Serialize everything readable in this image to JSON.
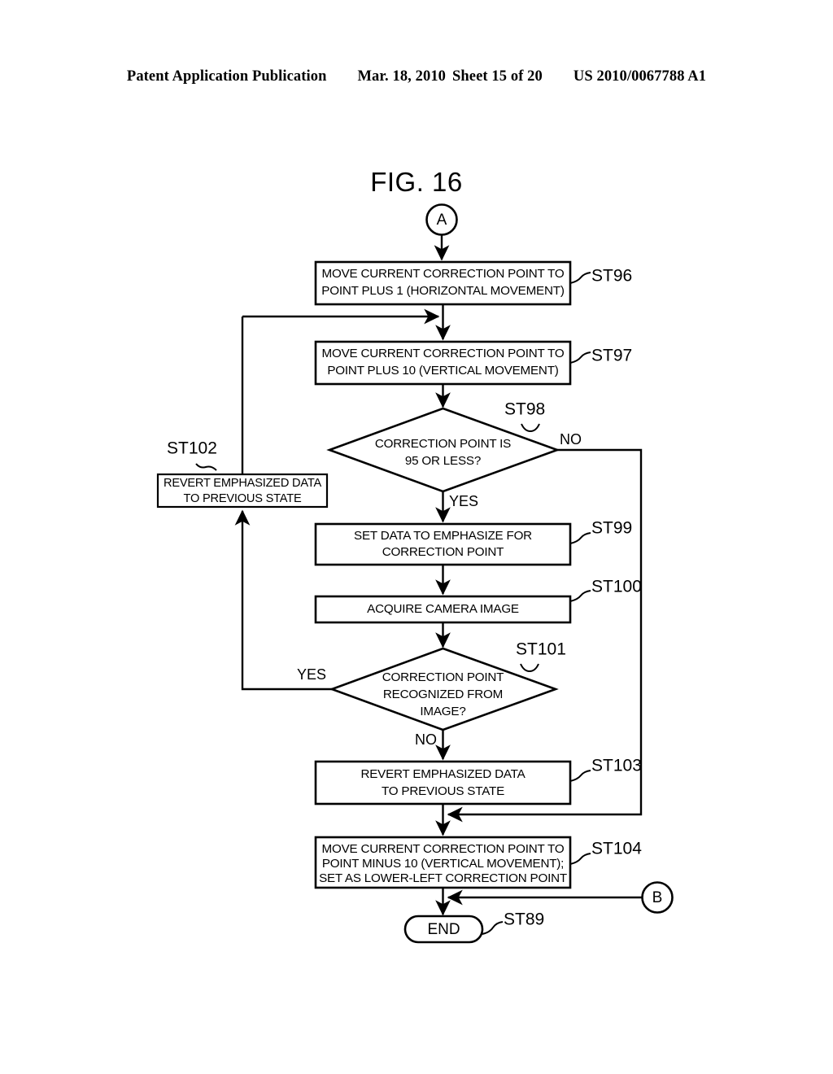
{
  "header": {
    "publication": "Patent Application Publication",
    "date": "Mar. 18, 2010",
    "sheet": "Sheet 15 of 20",
    "patent_number": "US 2010/0067788 A1"
  },
  "figure": {
    "title": "FIG. 16"
  },
  "flowchart": {
    "connector_in": {
      "label": "A",
      "ref": ""
    },
    "connector_b": {
      "label": "B"
    },
    "nodes": [
      {
        "id": "st96",
        "ref": "ST96",
        "type": "process",
        "lines": [
          "MOVE CURRENT CORRECTION POINT TO",
          "POINT PLUS 1 (HORIZONTAL MOVEMENT)"
        ]
      },
      {
        "id": "st97",
        "ref": "ST97",
        "type": "process",
        "lines": [
          "MOVE CURRENT CORRECTION POINT TO",
          "POINT PLUS 10 (VERTICAL MOVEMENT)"
        ]
      },
      {
        "id": "st98",
        "ref": "ST98",
        "type": "decision",
        "lines": [
          "CORRECTION POINT IS",
          "95 OR LESS?"
        ],
        "yes_label": "YES",
        "no_label": "NO"
      },
      {
        "id": "st102",
        "ref": "ST102",
        "type": "process",
        "lines": [
          "REVERT EMPHASIZED DATA",
          "TO PREVIOUS STATE"
        ]
      },
      {
        "id": "st99",
        "ref": "ST99",
        "type": "process",
        "lines": [
          "SET DATA TO EMPHASIZE FOR",
          "CORRECTION POINT"
        ]
      },
      {
        "id": "st100",
        "ref": "ST100",
        "type": "process",
        "lines": [
          "ACQUIRE CAMERA IMAGE"
        ]
      },
      {
        "id": "st101",
        "ref": "ST101",
        "type": "decision",
        "lines": [
          "CORRECTION POINT",
          "RECOGNIZED FROM",
          "IMAGE?"
        ],
        "yes_label": "YES",
        "no_label": "NO"
      },
      {
        "id": "st103",
        "ref": "ST103",
        "type": "process",
        "lines": [
          "REVERT EMPHASIZED DATA",
          "TO PREVIOUS STATE"
        ]
      },
      {
        "id": "st104",
        "ref": "ST104",
        "type": "process",
        "lines": [
          "MOVE CURRENT CORRECTION POINT TO",
          "POINT MINUS 10 (VERTICAL MOVEMENT);",
          "SET AS LOWER-LEFT CORRECTION POINT"
        ]
      },
      {
        "id": "st89",
        "ref": "ST89",
        "type": "terminator",
        "lines": [
          "END"
        ]
      }
    ]
  }
}
